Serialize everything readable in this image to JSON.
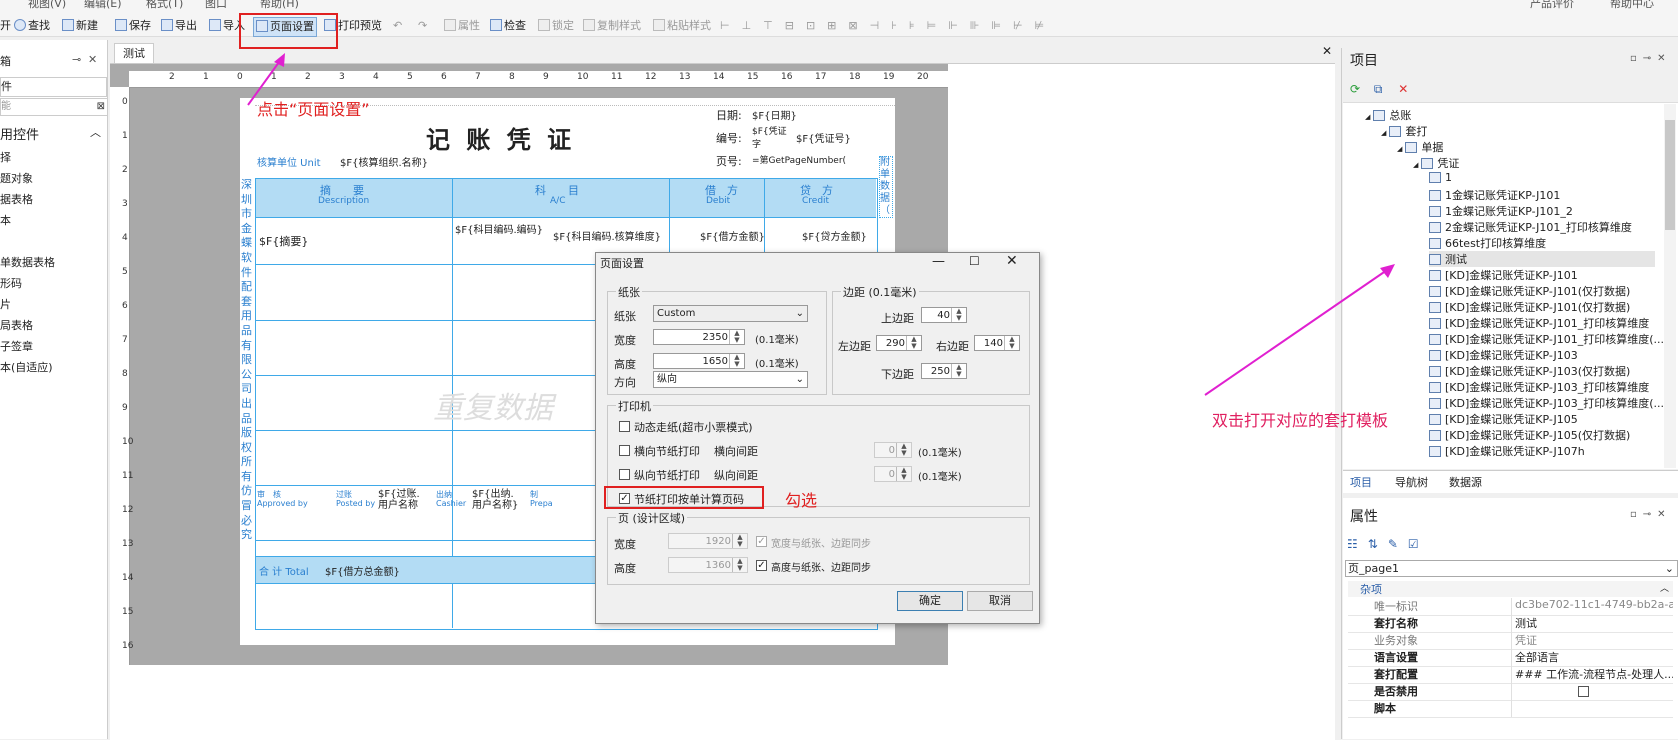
{
  "toolbar": {
    "menu_partial": [
      "视图(V)",
      "编辑(E)",
      "格式(T)",
      "图口",
      "帮助(H)"
    ],
    "items": [
      {
        "label": "开",
        "icon": "open-icon"
      },
      {
        "label": "查找",
        "icon": "search-icon"
      },
      {
        "label": "新建",
        "icon": "new-icon"
      },
      {
        "label": "保存",
        "icon": "save-icon"
      },
      {
        "label": "导出",
        "icon": "export-icon"
      },
      {
        "label": "导入",
        "icon": "import-icon"
      },
      {
        "label": "页面设置",
        "icon": "page-setup-icon"
      },
      {
        "label": "打印预览",
        "icon": "print-preview-icon"
      },
      {
        "label": "属性",
        "icon": "property-icon"
      },
      {
        "label": "检查",
        "icon": "check-icon"
      },
      {
        "label": "锁定",
        "icon": "lock-icon"
      },
      {
        "label": "复制样式",
        "icon": "copy-style-icon"
      },
      {
        "label": "粘贴样式",
        "icon": "paste-style-icon"
      }
    ],
    "right_partial": [
      "产品评价",
      "帮助中心"
    ]
  },
  "left_panel": {
    "title": "箱",
    "search_value": "件",
    "search_placeholder": "能",
    "section_title": "用控件",
    "items": [
      "择",
      "题对象",
      "据表格",
      "本",
      "",
      "单数据表格",
      "形码",
      "片",
      "局表格",
      "子签章",
      "本(自适应)"
    ]
  },
  "document": {
    "tab": "测试",
    "ruler_h": [
      "2",
      "1",
      "0",
      "1",
      "2",
      "3",
      "4",
      "5",
      "6",
      "7",
      "8",
      "9",
      "10",
      "11",
      "12",
      "13",
      "14",
      "15",
      "16",
      "17",
      "18",
      "19",
      "20"
    ],
    "ruler_v": [
      "0",
      "1",
      "2",
      "3",
      "4",
      "5",
      "6",
      "7",
      "8",
      "9",
      "10",
      "11",
      "12",
      "13",
      "14",
      "15",
      "16"
    ],
    "form": {
      "title": "记 账 凭 证",
      "date_label": "日期:",
      "date_value": "$F{日期}",
      "number_label": "编号:",
      "number_value1": "$F{凭证字",
      "number_value2": "$F{凭证号}",
      "page_label": "页号:",
      "page_value": "=第GetPageNumber(",
      "unit_label": "核算单位 Unit",
      "unit_value": "$F{核算组织.名称}",
      "col_summary": "摘　　要",
      "col_summary_en": "Description",
      "col_account": "科　　目",
      "col_account_en": "A/C",
      "col_debit": "借　方",
      "col_debit_en": "Debit",
      "col_credit": "贷　方",
      "col_credit_en": "Credit",
      "row_summary": "$F{摘要}",
      "row_account1": "$F{科目编码.编码}",
      "row_account2": "$F{科目编码.核算维度}",
      "row_debit": "$F{借方金额}",
      "row_credit": "$F{贷方金额}",
      "side_vertical": "深圳市金蝶软件配套用品有限公司出品　版权所有　仿冒必究",
      "side_right": "附单数据（",
      "watermark": "重复数据",
      "total_label": "合 计 Total",
      "total_value": "$F{借方总金额}",
      "sign1": "过账",
      "sign1_val": "$F{过账.用户名称",
      "sign2": "出纳",
      "sign2_val": "$F{出纳.用户名称}",
      "sign_approved": "Approved by",
      "sign_posted": "Posted by",
      "sign_cashier": "Cashier",
      "sign_prepared": "Prepa"
    }
  },
  "dialog": {
    "title": "页面设置",
    "paper_group": "纸张",
    "paper_label": "纸张",
    "paper_value": "Custom",
    "width_label": "宽度",
    "width_value": "2350",
    "height_label": "高度",
    "height_value": "1650",
    "unit": "(0.1毫米)",
    "orient_label": "方向",
    "orient_value": "纵向",
    "margin_group": "边距 (0.1毫米)",
    "top_label": "上边距",
    "top_value": "40",
    "left_label": "左边距",
    "left_value": "290",
    "right_label": "右边距",
    "right_value": "140",
    "bottom_label": "下边距",
    "bottom_value": "250",
    "print_group": "打印机",
    "dynamic_label": "动态走纸(超市小票模式)",
    "hsection_label": "横向节纸打印",
    "hgap_label": "横向间距",
    "hgap_value": "0",
    "vsection_label": "纵向节纸打印",
    "vgap_label": "纵向间距",
    "vgap_value": "0",
    "gap_unit": "(0.1毫米)",
    "section_page_label": "节纸打印按单计算页码",
    "page_group": "页 (设计区域)",
    "pwidth_label": "宽度",
    "pwidth_value": "1920",
    "pheight_label": "高度",
    "pheight_value": "1360",
    "sync_w_label": "宽度与纸张、边距同步",
    "sync_h_label": "高度与纸张、边距同步",
    "ok": "确定",
    "cancel": "取消"
  },
  "annotations": {
    "click_page_setup": "点击“页面设置”",
    "check": "勾选",
    "double_click": "双击打开对应的套打模板"
  },
  "project_panel": {
    "title": "项目",
    "tree": [
      {
        "label": "总账",
        "level": 0
      },
      {
        "label": "套打",
        "level": 1
      },
      {
        "label": "单据",
        "level": 2
      },
      {
        "label": "凭证",
        "level": 3
      },
      {
        "label": "1",
        "level": 4
      },
      {
        "label": "1金蝶记账凭证KP-J101",
        "level": 4
      },
      {
        "label": "1金蝶记账凭证KP-J101_2",
        "level": 4
      },
      {
        "label": "2金蝶记账凭证KP-J101_打印核算维度",
        "level": 4
      },
      {
        "label": "66test打印核算维度",
        "level": 4
      },
      {
        "label": "测试",
        "level": 4,
        "selected": true
      },
      {
        "label": "[KD]金蝶记账凭证KP-J101",
        "level": 4
      },
      {
        "label": "[KD]金蝶记账凭证KP-J101(仅打数据)",
        "level": 4
      },
      {
        "label": "[KD]金蝶记账凭证KP-J101(仅打数据)",
        "level": 4
      },
      {
        "label": "[KD]金蝶记账凭证KP-J101_打印核算维度",
        "level": 4
      },
      {
        "label": "[KD]金蝶记账凭证KP-J101_打印核算维度(...",
        "level": 4
      },
      {
        "label": "[KD]金蝶记账凭证KP-J103",
        "level": 4
      },
      {
        "label": "[KD]金蝶记账凭证KP-J103(仅打数据)",
        "level": 4
      },
      {
        "label": "[KD]金蝶记账凭证KP-J103_打印核算维度",
        "level": 4
      },
      {
        "label": "[KD]金蝶记账凭证KP-J103_打印核算维度(...",
        "level": 4
      },
      {
        "label": "[KD]金蝶记账凭证KP-J105",
        "level": 4
      },
      {
        "label": "[KD]金蝶记账凭证KP-J105(仅打数据)",
        "level": 4
      },
      {
        "label": "[KD]金蝶记账凭证KP-J107h",
        "level": 4
      }
    ],
    "tabs": [
      "项目",
      "导航树",
      "数据源"
    ]
  },
  "property_panel": {
    "title": "属性",
    "selector": "页_page1",
    "category": "杂项",
    "rows": [
      {
        "key": "唯一标识",
        "value": "dc3be702-11c1-4749-bb2a-a7...",
        "bold": false
      },
      {
        "key": "套打名称",
        "value": "测试",
        "bold": true
      },
      {
        "key": "业务对象",
        "value": "凭证",
        "bold": false
      },
      {
        "key": "语言设置",
        "value": "全部语言",
        "bold": true
      },
      {
        "key": "套打配置",
        "value": "### 工作流-流程节点-处理人...",
        "bold": true
      },
      {
        "key": "是否禁用",
        "value": "",
        "bold": true
      },
      {
        "key": "脚本",
        "value": "",
        "bold": true
      }
    ]
  },
  "colors": {
    "accent": "#e02020",
    "annotation": "#e020d0",
    "form_blue": "#3fa9e8",
    "header_fill": "#b3dcf4"
  }
}
